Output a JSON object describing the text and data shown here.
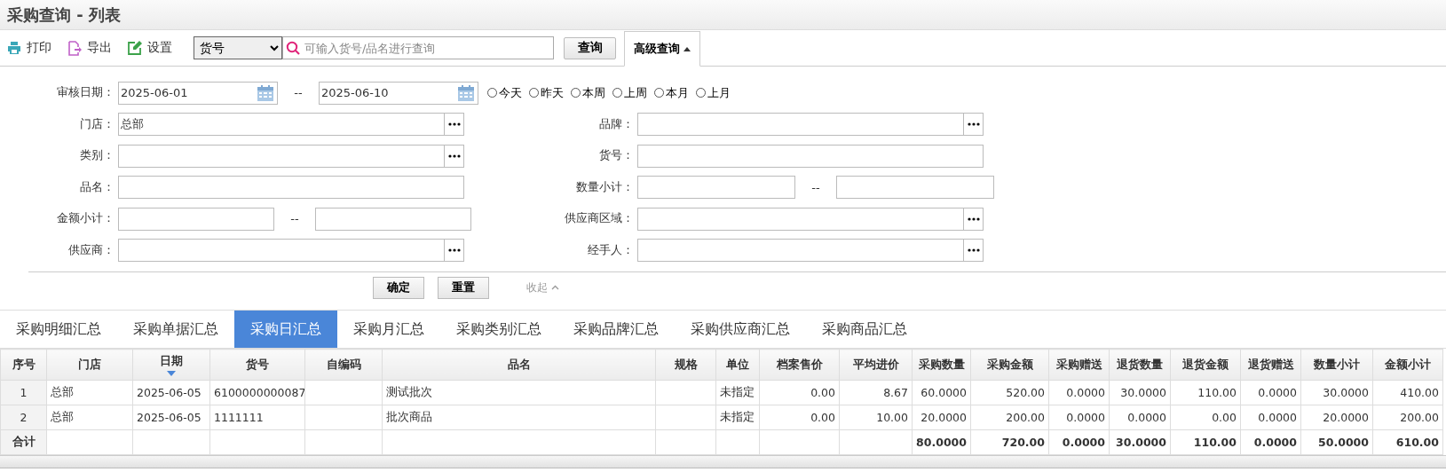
{
  "window": {
    "title": "采购查询 - 列表"
  },
  "toolbar": {
    "buttons": [
      {
        "kind": "print",
        "label": "打印"
      },
      {
        "kind": "export",
        "label": "导出"
      },
      {
        "kind": "settings",
        "label": "设置"
      }
    ],
    "search_type": "货号",
    "search": {
      "placeholder": "可输入货号/品名进行查询"
    },
    "query_button": "查询",
    "advanced": {
      "label": "高级查询",
      "expanded": true
    }
  },
  "form": {
    "date": {
      "label": "审核日期：",
      "from": "2025-06-01",
      "separator": "--",
      "to": "2025-06-10"
    },
    "presets": [
      {
        "label": "今天",
        "selected": false
      },
      {
        "label": "昨天",
        "selected": false
      },
      {
        "label": "本周",
        "selected": false
      },
      {
        "label": "上周",
        "selected": false
      },
      {
        "label": "本月",
        "selected": false
      },
      {
        "label": "上月",
        "selected": false
      }
    ],
    "rows": [
      [
        {
          "kind": "picker",
          "label": "门店：",
          "value": "总部"
        },
        {
          "kind": "picker",
          "label": "品牌："
        }
      ],
      [
        {
          "kind": "picker",
          "label": "类别："
        },
        {
          "kind": "text",
          "label": "货号："
        }
      ],
      [
        {
          "kind": "text",
          "label": "品名："
        },
        {
          "kind": "range",
          "label": "数量小计：",
          "separator": "--"
        }
      ],
      [
        {
          "kind": "range",
          "label": "金额小计：",
          "separator": "--"
        },
        {
          "kind": "picker",
          "label": "供应商区域："
        }
      ],
      [
        {
          "kind": "picker",
          "label": "供应商："
        },
        {
          "kind": "picker",
          "label": "经手人："
        }
      ]
    ],
    "confirm_button": "确定",
    "reset_button": "重置",
    "collapse_link": "收起"
  },
  "tabs": [
    {
      "label": "采购明细汇总",
      "selected": false
    },
    {
      "label": "采购单据汇总",
      "selected": false
    },
    {
      "label": "采购日汇总",
      "selected": true
    },
    {
      "label": "采购月汇总",
      "selected": false
    },
    {
      "label": "采购类别汇总",
      "selected": false
    },
    {
      "label": "采购品牌汇总",
      "selected": false
    },
    {
      "label": "采购供应商汇总",
      "selected": false
    },
    {
      "label": "采购商品汇总",
      "selected": false
    }
  ],
  "table": {
    "columns": [
      {
        "label": "序号",
        "sorted": false
      },
      {
        "label": "门店",
        "sorted": false
      },
      {
        "label": "日期",
        "sorted": true
      },
      {
        "label": "货号",
        "sorted": false
      },
      {
        "label": "自编码",
        "sorted": false
      },
      {
        "label": "品名",
        "sorted": false
      },
      {
        "label": "规格",
        "sorted": false
      },
      {
        "label": "单位",
        "sorted": false
      },
      {
        "label": "档案售价",
        "sorted": false
      },
      {
        "label": "平均进价",
        "sorted": false
      },
      {
        "label": "采购数量",
        "sorted": false
      },
      {
        "label": "采购金额",
        "sorted": false
      },
      {
        "label": "采购赠送",
        "sorted": false
      },
      {
        "label": "退货数量",
        "sorted": false
      },
      {
        "label": "退货金额",
        "sorted": false
      },
      {
        "label": "退货赠送",
        "sorted": false
      },
      {
        "label": "数量小计",
        "sorted": false
      },
      {
        "label": "金额小计",
        "sorted": false
      }
    ],
    "rows": [
      [
        "1",
        "总部",
        "2025-06-05",
        "6100000000087",
        null,
        "测试批次",
        null,
        "未指定",
        "0.00",
        "8.67",
        "60.0000",
        "520.00",
        "0.0000",
        "30.0000",
        "110.00",
        "0.0000",
        "30.0000",
        "410.00"
      ],
      [
        "2",
        "总部",
        "2025-06-05",
        "1111111",
        null,
        "批次商品",
        null,
        "未指定",
        "0.00",
        "10.00",
        "20.0000",
        "200.00",
        "0.0000",
        "0.0000",
        "0.00",
        "0.0000",
        "20.0000",
        "200.00"
      ]
    ],
    "totals": {
      "label": "合计",
      "values": [
        "80.0000",
        "720.00",
        "0.0000",
        "30.0000",
        "110.00",
        "0.0000",
        "50.0000",
        "610.00"
      ]
    }
  }
}
